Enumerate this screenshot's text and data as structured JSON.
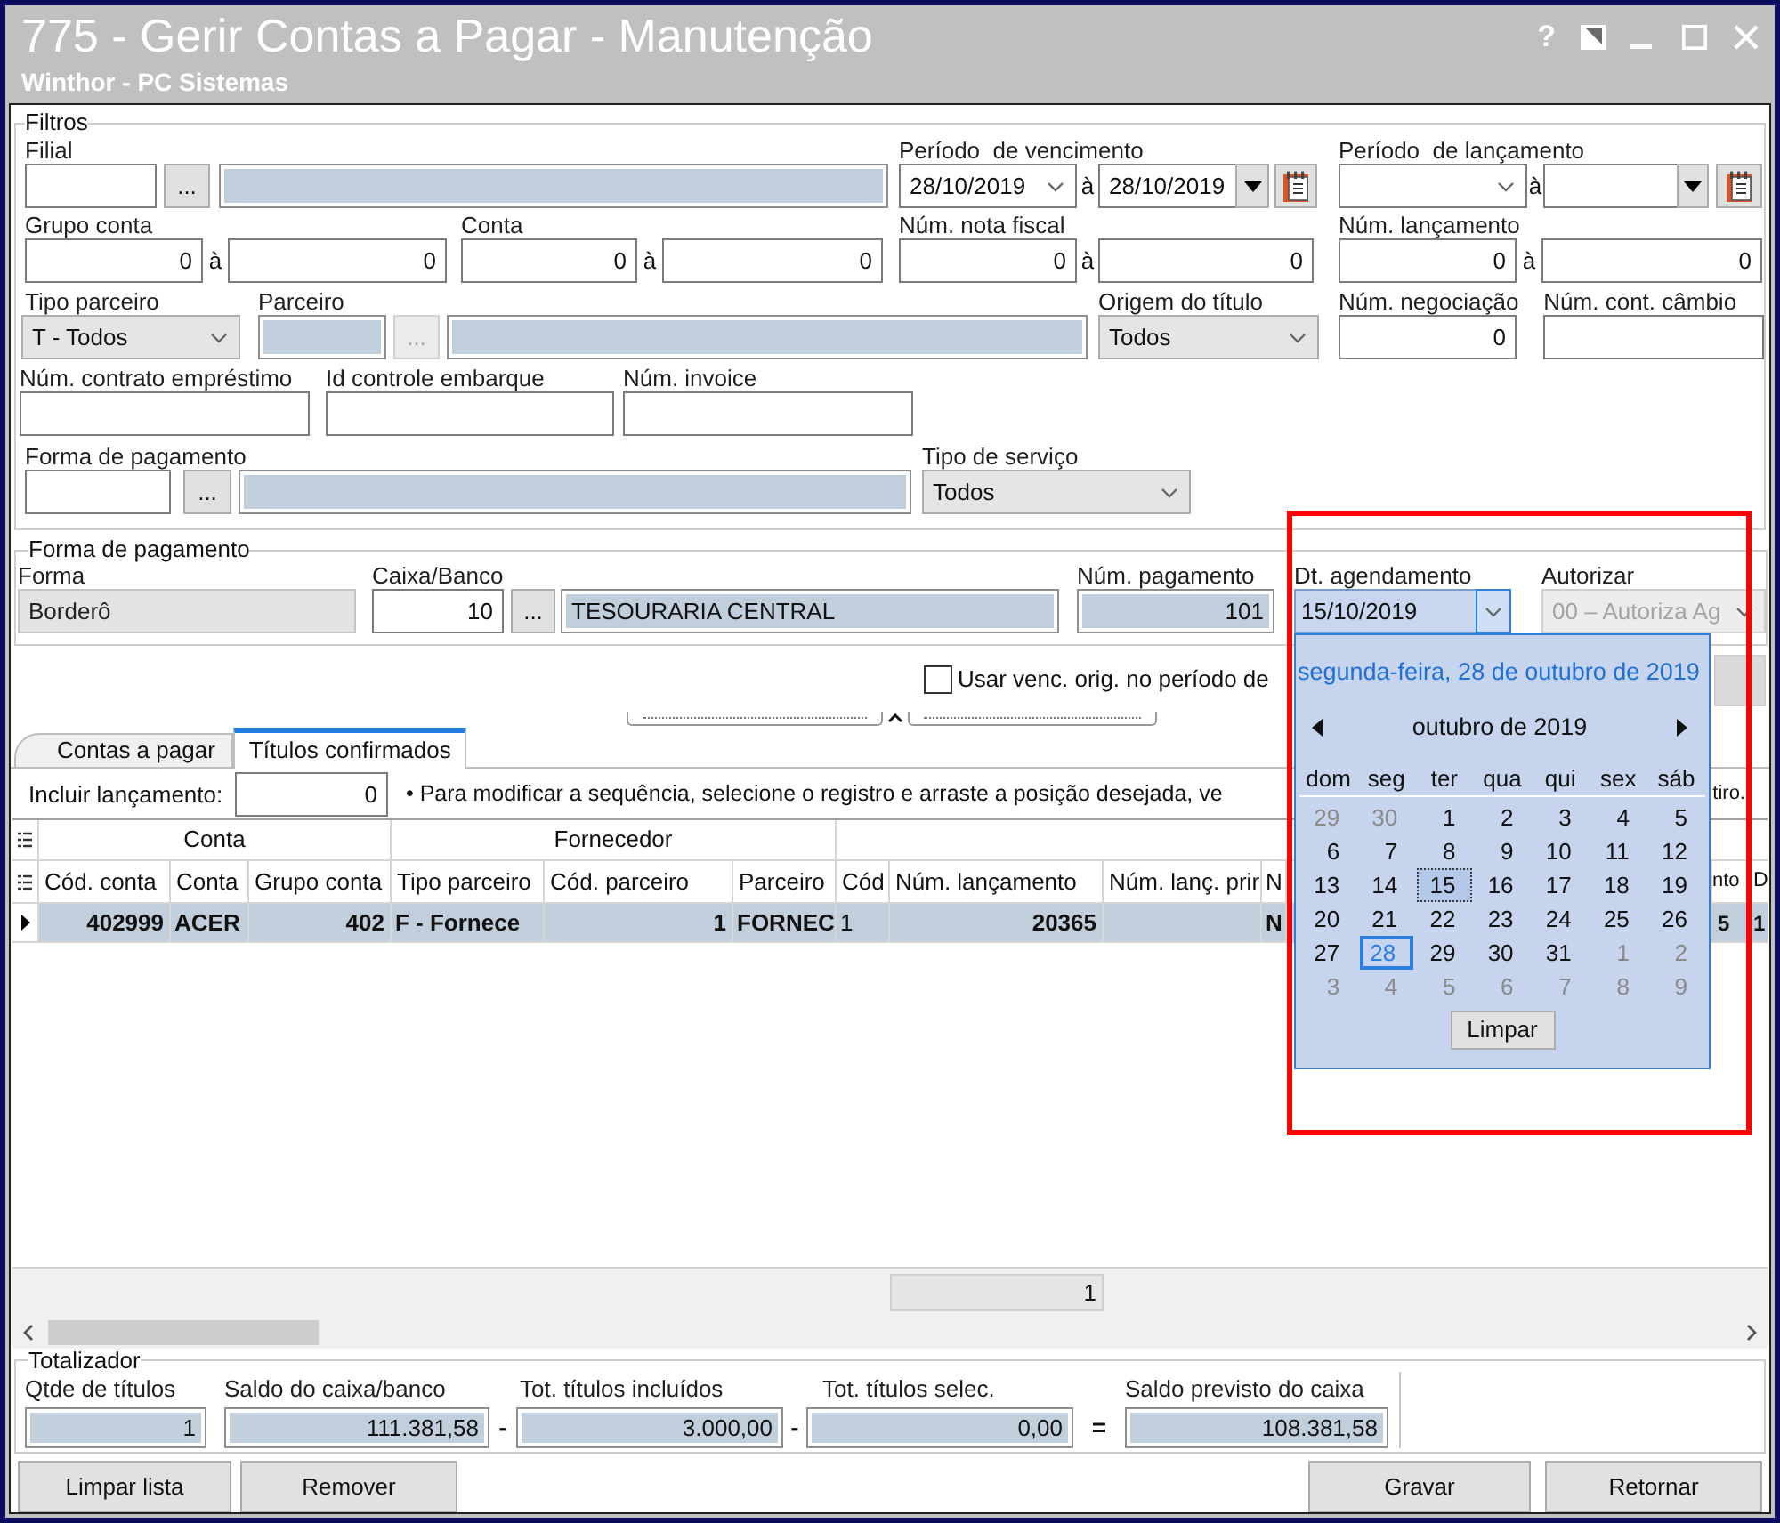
{
  "window": {
    "title": "775 - Gerir Contas a Pagar - Manutenção",
    "subtitle": "Winthor - PC Sistemas",
    "help": "?"
  },
  "filters": {
    "legend": "Filtros",
    "filial": {
      "label": "Filial",
      "code": {
        "readonly": false
      },
      "lookup": {
        "text": "...",
        "disabled": false
      },
      "description": {
        "readonly": true
      }
    },
    "vencimento": {
      "label": "Período  de vencimento",
      "from": {
        "value": "28/10/2019"
      },
      "sep": "à",
      "to": {
        "value": "28/10/2019"
      }
    },
    "periodo_lancamento": {
      "label": "Período  de lançamento",
      "sep": "à"
    },
    "grupo_conta": {
      "label": "Grupo conta",
      "from": {
        "value": "0",
        "readonly": false
      },
      "sep": "à",
      "to": {
        "value": "0",
        "readonly": false
      }
    },
    "conta": {
      "label": "Conta",
      "from": {
        "value": "0",
        "readonly": false
      },
      "sep": "à",
      "to": {
        "value": "0",
        "readonly": false
      }
    },
    "nota_fiscal": {
      "label": "Núm. nota fiscal",
      "from": {
        "value": "0",
        "readonly": false
      },
      "sep": "à",
      "to": {
        "value": "0",
        "readonly": false
      }
    },
    "num_lancamento": {
      "label": "Núm. lançamento",
      "from": {
        "value": "0",
        "readonly": false
      },
      "sep": "à",
      "to": {
        "value": "0",
        "readonly": false
      }
    },
    "tipo_parceiro": {
      "label": "Tipo parceiro",
      "value": "T - Todos",
      "disabled": false
    },
    "parceiro": {
      "label": "Parceiro",
      "code": {
        "readonly": true
      },
      "lookup": {
        "text": "...",
        "disabled": true
      },
      "description": {
        "readonly": true
      }
    },
    "origem": {
      "label": "Origem do título",
      "value": "Todos",
      "disabled": false
    },
    "negociacao": {
      "label": "Núm. negociação",
      "value": "0",
      "readonly": false
    },
    "cambio": {
      "label": "Núm. cont. câmbio",
      "readonly": false
    },
    "contrato": {
      "label": "Núm. contrato empréstimo",
      "readonly": false
    },
    "embarque": {
      "label": "Id controle embarque",
      "readonly": false
    },
    "invoice": {
      "label": "Núm. invoice",
      "readonly": false
    },
    "forma_pagamento": {
      "label": "Forma de pagamento",
      "code": {
        "readonly": false
      },
      "lookup": {
        "text": "...",
        "disabled": false
      },
      "description": {
        "readonly": true
      }
    },
    "tipo_servico": {
      "label": "Tipo de serviço",
      "value": "Todos",
      "disabled": false
    }
  },
  "payment": {
    "legend": "Forma de pagamento",
    "forma": {
      "label": "Forma",
      "value": "Borderô",
      "disabled": true
    },
    "caixa": {
      "label": "Caixa/Banco",
      "code": {
        "value": "10",
        "readonly": false
      },
      "lookup": {
        "text": "...",
        "disabled": false
      },
      "description": {
        "value": "TESOURARIA CENTRAL",
        "readonly": true
      }
    },
    "num_pagamento": {
      "label": "Núm. pagamento",
      "value": "101",
      "readonly": true
    },
    "agendamento": {
      "label": "Dt. agendamento",
      "value": "15/10/2019",
      "expanded": true
    },
    "autorizar": {
      "label": "Autorizar",
      "value": "00 – Autoriza Ag",
      "disabled": true
    }
  },
  "options": {
    "usar_venc": {
      "label": "Usar venc. orig. no período de",
      "checked": false
    }
  },
  "tabs": [
    {
      "label": "Contas a pagar",
      "selected": false
    },
    {
      "label": "Títulos confirmados",
      "selected": true
    }
  ],
  "include": {
    "label": "Incluir lançamento:",
    "value": "0",
    "hint": "• Para modificar a sequência, selecione o registro e arraste a posição desejada, ve",
    "hint_end": "tiro."
  },
  "grid": {
    "column_groups": [
      {
        "label": "Conta",
        "columns": [
          "Cód. conta",
          "Conta",
          "Grupo conta"
        ]
      },
      {
        "label": "Fornecedor",
        "columns": [
          "Tipo parceiro",
          "Cód. parceiro",
          "Parceiro"
        ]
      },
      {
        "columns": [
          "Cód",
          "Núm. lançamento",
          "Núm. lanç. prir",
          "N",
          "nto",
          "D"
        ]
      }
    ],
    "rows": [
      {
        "selected": true,
        "cod_conta": "402999",
        "conta": "ACER",
        "grupo_conta": "402",
        "tipo_parceiro": "F - Fornece",
        "cod_parceiro": "1",
        "parceiro": "FORNEC",
        "cod": "1",
        "num_lancamento": "20365",
        "column_10": "N",
        "column_11": "5",
        "column_12": "1"
      }
    ],
    "footer": {
      "num_lancamento": "1"
    }
  },
  "totals": {
    "legend": "Totalizador",
    "items": [
      {
        "label": "Qtde de títulos",
        "value": "1",
        "readonly": true
      },
      {
        "label": "Saldo do caixa/banco",
        "value": "111.381,58",
        "readonly": true,
        "operator": "-"
      },
      {
        "label": "Tot. títulos incluídos",
        "value": "3.000,00",
        "readonly": true,
        "operator": "-"
      },
      {
        "label": "Tot. títulos selec.",
        "value": "0,00",
        "readonly": true,
        "operator": "="
      },
      {
        "label": "Saldo previsto do caixa",
        "value": "108.381,58",
        "readonly": true
      }
    ]
  },
  "buttons": {
    "left": [
      "Limpar lista",
      "Remover"
    ],
    "right": [
      "Gravar",
      "Retornar"
    ]
  },
  "calendar": {
    "caption": "segunda-feira, 28 de outubro de 2019",
    "month": "outubro de 2019",
    "weekdays": [
      "dom",
      "seg",
      "ter",
      "qua",
      "qui",
      "sex",
      "sáb"
    ],
    "weeks": [
      [
        {
          "day": "29",
          "muted": true,
          "selected": false,
          "today": false
        },
        {
          "day": "30",
          "muted": true,
          "selected": false,
          "today": false
        },
        {
          "day": "1",
          "muted": false,
          "selected": false,
          "today": false
        },
        {
          "day": "2",
          "muted": false,
          "selected": false,
          "today": false
        },
        {
          "day": "3",
          "muted": false,
          "selected": false,
          "today": false
        },
        {
          "day": "4",
          "muted": false,
          "selected": false,
          "today": false
        },
        {
          "day": "5",
          "muted": false,
          "selected": false,
          "today": false
        }
      ],
      [
        {
          "day": "6",
          "muted": false,
          "selected": false,
          "today": false
        },
        {
          "day": "7",
          "muted": false,
          "selected": false,
          "today": false
        },
        {
          "day": "8",
          "muted": false,
          "selected": false,
          "today": false
        },
        {
          "day": "9",
          "muted": false,
          "selected": false,
          "today": false
        },
        {
          "day": "10",
          "muted": false,
          "selected": false,
          "today": false
        },
        {
          "day": "11",
          "muted": false,
          "selected": false,
          "today": false
        },
        {
          "day": "12",
          "muted": false,
          "selected": false,
          "today": false
        }
      ],
      [
        {
          "day": "13",
          "muted": false,
          "selected": false,
          "today": false
        },
        {
          "day": "14",
          "muted": false,
          "selected": false,
          "today": false
        },
        {
          "day": "15",
          "muted": false,
          "selected": true,
          "today": false
        },
        {
          "day": "16",
          "muted": false,
          "selected": false,
          "today": false
        },
        {
          "day": "17",
          "muted": false,
          "selected": false,
          "today": false
        },
        {
          "day": "18",
          "muted": false,
          "selected": false,
          "today": false
        },
        {
          "day": "19",
          "muted": false,
          "selected": false,
          "today": false
        }
      ],
      [
        {
          "day": "20",
          "muted": false,
          "selected": false,
          "today": false
        },
        {
          "day": "21",
          "muted": false,
          "selected": false,
          "today": false
        },
        {
          "day": "22",
          "muted": false,
          "selected": false,
          "today": false
        },
        {
          "day": "23",
          "muted": false,
          "selected": false,
          "today": false
        },
        {
          "day": "24",
          "muted": false,
          "selected": false,
          "today": false
        },
        {
          "day": "25",
          "muted": false,
          "selected": false,
          "today": false
        },
        {
          "day": "26",
          "muted": false,
          "selected": false,
          "today": false
        }
      ],
      [
        {
          "day": "27",
          "muted": false,
          "selected": false,
          "today": false
        },
        {
          "day": "28",
          "muted": false,
          "selected": false,
          "today": true
        },
        {
          "day": "29",
          "muted": false,
          "selected": false,
          "today": false
        },
        {
          "day": "30",
          "muted": false,
          "selected": false,
          "today": false
        },
        {
          "day": "31",
          "muted": false,
          "selected": false,
          "today": false
        },
        {
          "day": "1",
          "muted": true,
          "selected": false,
          "today": false
        },
        {
          "day": "2",
          "muted": true,
          "selected": false,
          "today": false
        }
      ],
      [
        {
          "day": "3",
          "muted": true,
          "selected": false,
          "today": false
        },
        {
          "day": "4",
          "muted": true,
          "selected": false,
          "today": false
        },
        {
          "day": "5",
          "muted": true,
          "selected": false,
          "today": false
        },
        {
          "day": "6",
          "muted": true,
          "selected": false,
          "today": false
        },
        {
          "day": "7",
          "muted": true,
          "selected": false,
          "today": false
        },
        {
          "day": "8",
          "muted": true,
          "selected": false,
          "today": false
        },
        {
          "day": "9",
          "muted": true,
          "selected": false,
          "today": false
        }
      ]
    ],
    "clear": "Limpar"
  },
  "annotations": [
    {
      "kind": "frame"
    }
  ]
}
